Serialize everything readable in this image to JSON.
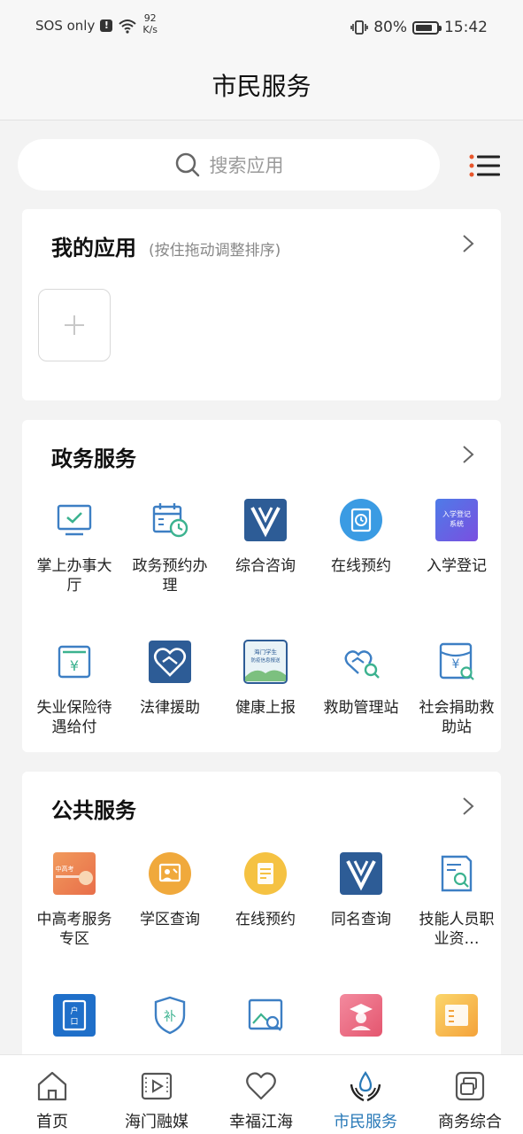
{
  "status_bar": {
    "carrier": "SOS only",
    "network_speed_value": "92",
    "network_speed_unit": "K/s",
    "battery_percent": "80%",
    "battery_level": 0.8,
    "time": "15:42"
  },
  "header": {
    "title": "市民服务"
  },
  "search": {
    "placeholder": "搜索应用"
  },
  "my_apps": {
    "title": "我的应用",
    "hint": "(按住拖动调整排序)"
  },
  "gov_services": {
    "title": "政务服务",
    "items": [
      {
        "label": "掌上办事大厅",
        "icon": "monitor-check-icon"
      },
      {
        "label": "政务预约办理",
        "icon": "calendar-clock-icon"
      },
      {
        "label": "综合咨询",
        "icon": "v-logo-icon"
      },
      {
        "label": "在线预约",
        "icon": "clipboard-clock-icon"
      },
      {
        "label": "入学登记",
        "icon": "enrollment-system-icon",
        "icon_text": "入学登记系统"
      },
      {
        "label": "失业保险待遇给付",
        "icon": "yen-card-icon"
      },
      {
        "label": "法律援助",
        "icon": "heart-handshake-icon"
      },
      {
        "label": "健康上报",
        "icon": "health-report-icon",
        "icon_text": "海门学生防疫信息报送"
      },
      {
        "label": "救助管理站",
        "icon": "helping-hand-search-icon"
      },
      {
        "label": "社会捐助救助站",
        "icon": "donation-search-icon"
      }
    ]
  },
  "public_services": {
    "title": "公共服务",
    "items": [
      {
        "label": "中高考服务专区",
        "icon": "exam-banner-icon",
        "icon_text": "中高考"
      },
      {
        "label": "学区查询",
        "icon": "school-district-icon"
      },
      {
        "label": "在线预约",
        "icon": "document-yellow-icon"
      },
      {
        "label": "同名查询",
        "icon": "v-logo-icon"
      },
      {
        "label": "技能人员职业资…",
        "icon": "certificate-search-icon"
      },
      {
        "label": "",
        "icon": "household-register-icon",
        "icon_text": "户口"
      },
      {
        "label": "",
        "icon": "subsidy-shield-icon",
        "icon_text": "补"
      },
      {
        "label": "",
        "icon": "image-search-icon"
      },
      {
        "label": "",
        "icon": "graduate-icon"
      },
      {
        "label": "",
        "icon": "orange-form-icon"
      }
    ]
  },
  "tabbar": {
    "active_color": "#2a7ab8",
    "tabs": [
      {
        "label": "首页",
        "icon": "home-icon"
      },
      {
        "label": "海门融媒",
        "icon": "media-play-icon"
      },
      {
        "label": "幸福江海",
        "icon": "heart-icon"
      },
      {
        "label": "市民服务",
        "icon": "water-hands-icon",
        "active": true
      },
      {
        "label": "商务综合",
        "icon": "business-icon"
      }
    ]
  }
}
